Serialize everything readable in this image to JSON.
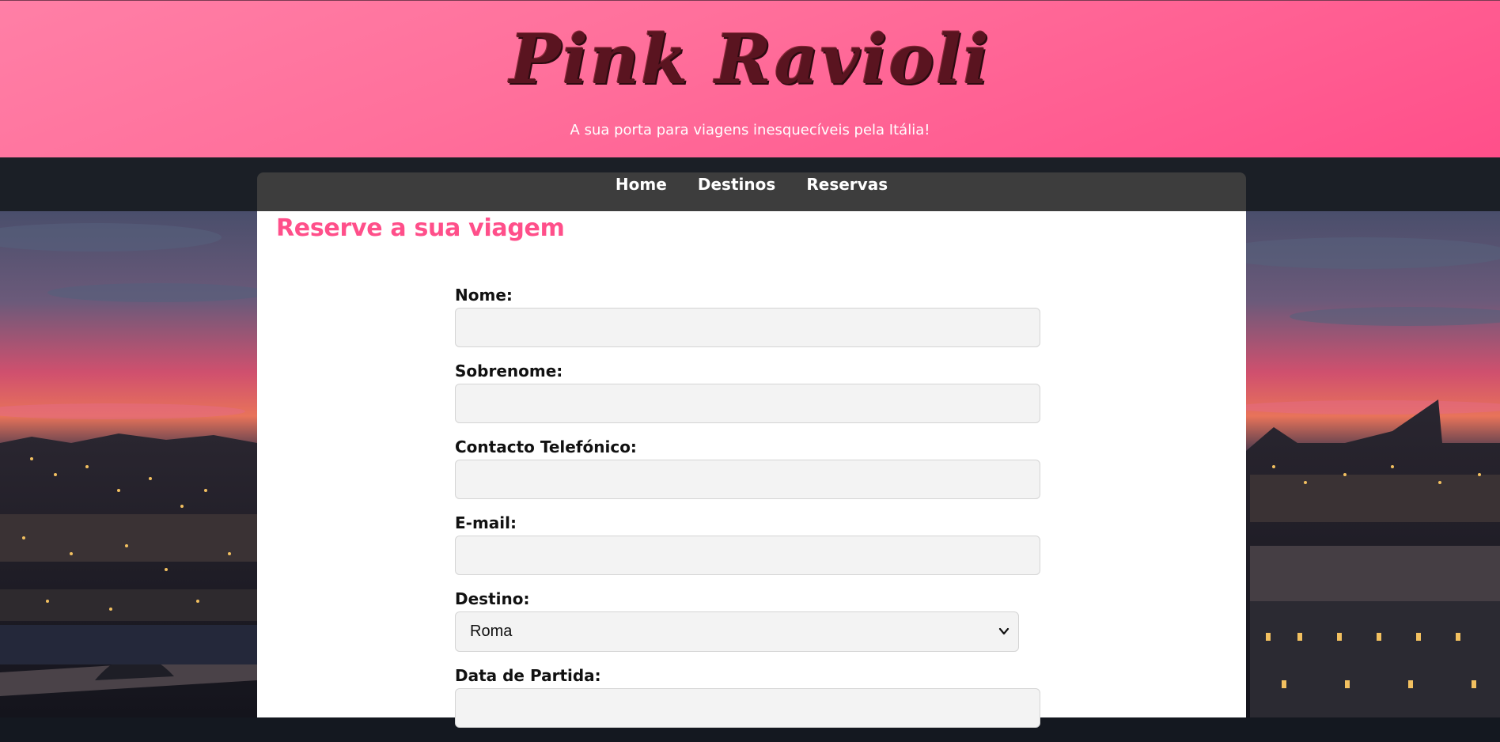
{
  "header": {
    "logo_text": "Pink Ravioli",
    "tagline": "A sua porta para viagens inesquecíveis pela Itália!"
  },
  "nav": {
    "items": [
      {
        "label": "Home"
      },
      {
        "label": "Destinos"
      },
      {
        "label": "Reservas"
      }
    ]
  },
  "main": {
    "title": "Reserve a sua viagem",
    "form": {
      "fields": [
        {
          "label": "Nome:",
          "value": ""
        },
        {
          "label": "Sobrenome:",
          "value": ""
        },
        {
          "label": "Contacto Telefónico:",
          "value": ""
        },
        {
          "label": "E-mail:",
          "value": ""
        }
      ],
      "destination": {
        "label": "Destino:",
        "selected": "Roma"
      },
      "departure": {
        "label": "Data de Partida:",
        "value": ""
      }
    }
  },
  "colors": {
    "header_gradient_start": "#ff7fa6",
    "header_gradient_end": "#ff4f8a",
    "accent": "#ff4f8a",
    "logo": "#5a1420",
    "nav_bar": "#3d3d3d",
    "field_background": "#f3f3f3"
  },
  "icons": {
    "select_arrow": "chevron-down-icon"
  }
}
